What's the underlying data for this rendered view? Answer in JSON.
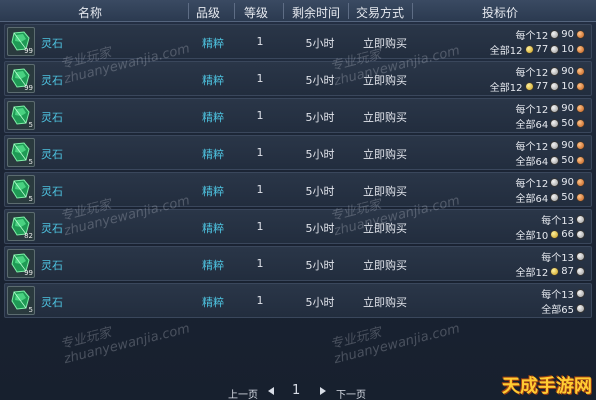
{
  "header": {
    "name": "名称",
    "quality": "品级",
    "level": "等级",
    "time_left": "剩余时间",
    "trade_method": "交易方式",
    "bid_price": "投标价"
  },
  "rows": [
    {
      "count": "99",
      "name": "灵石",
      "quality": "精粹",
      "level": "1",
      "time": "5小时",
      "trade": "立即购买",
      "line1": {
        "label": "每个12",
        "c1": "90",
        "c1_type": "silver",
        "c2": "",
        "c2_type": ""
      },
      "line2": {
        "label": "全部12",
        "c1": "77",
        "c1_type": "gold",
        "c2": "10",
        "c2_type": "silver"
      }
    },
    {
      "count": "99",
      "name": "灵石",
      "quality": "精粹",
      "level": "1",
      "time": "5小时",
      "trade": "立即购买",
      "line1": {
        "label": "每个12",
        "c1": "90",
        "c1_type": "silver",
        "c2": "",
        "c2_type": ""
      },
      "line2": {
        "label": "全部12",
        "c1": "77",
        "c1_type": "gold",
        "c2": "10",
        "c2_type": "silver"
      }
    },
    {
      "count": "5",
      "name": "灵石",
      "quality": "精粹",
      "level": "1",
      "time": "5小时",
      "trade": "立即购买",
      "line1": {
        "label": "每个12",
        "c1": "90",
        "c1_type": "silver",
        "c2": "",
        "c2_type": ""
      },
      "line2": {
        "label": "全部64",
        "c1": "50",
        "c1_type": "copper",
        "c2": "",
        "c2_type": ""
      }
    },
    {
      "count": "5",
      "name": "灵石",
      "quality": "精粹",
      "level": "1",
      "time": "5小时",
      "trade": "立即购买",
      "line1": {
        "label": "每个12",
        "c1": "90",
        "c1_type": "silver",
        "c2": "",
        "c2_type": ""
      },
      "line2": {
        "label": "全部64",
        "c1": "50",
        "c1_type": "copper",
        "c2": "",
        "c2_type": ""
      }
    },
    {
      "count": "5",
      "name": "灵石",
      "quality": "精粹",
      "level": "1",
      "time": "5小时",
      "trade": "立即购买",
      "line1": {
        "label": "每个12",
        "c1": "90",
        "c1_type": "silver",
        "c2": "",
        "c2_type": ""
      },
      "line2": {
        "label": "全部64",
        "c1": "50",
        "c1_type": "copper",
        "c2": "",
        "c2_type": ""
      }
    },
    {
      "count": "82",
      "name": "灵石",
      "quality": "精粹",
      "level": "1",
      "time": "5小时",
      "trade": "立即购买",
      "line1": {
        "label": "每个13",
        "c1": "",
        "c1_type": "silver",
        "c2": "",
        "c2_type": ""
      },
      "line2": {
        "label": "全部10",
        "c1": "66",
        "c1_type": "gold",
        "c2": "",
        "c2_type": "silver"
      }
    },
    {
      "count": "99",
      "name": "灵石",
      "quality": "精粹",
      "level": "1",
      "time": "5小时",
      "trade": "立即购买",
      "line1": {
        "label": "每个13",
        "c1": "",
        "c1_type": "silver",
        "c2": "",
        "c2_type": ""
      },
      "line2": {
        "label": "全部12",
        "c1": "87",
        "c1_type": "gold",
        "c2": "",
        "c2_type": "silver"
      }
    },
    {
      "count": "5",
      "name": "灵石",
      "quality": "精粹",
      "level": "1",
      "time": "5小时",
      "trade": "立即购买",
      "line1": {
        "label": "每个13",
        "c1": "",
        "c1_type": "silver",
        "c2": "",
        "c2_type": ""
      },
      "line2": {
        "label": "全部65",
        "c1": "",
        "c1_type": "silver",
        "c2": "",
        "c2_type": ""
      }
    }
  ],
  "watermark": {
    "cn": "专业玩家",
    "en": "zhuanyewanjia.com"
  },
  "pager": {
    "prev": "上一页",
    "page": "1",
    "next": "下一页"
  },
  "site_logo": "天成手游网"
}
